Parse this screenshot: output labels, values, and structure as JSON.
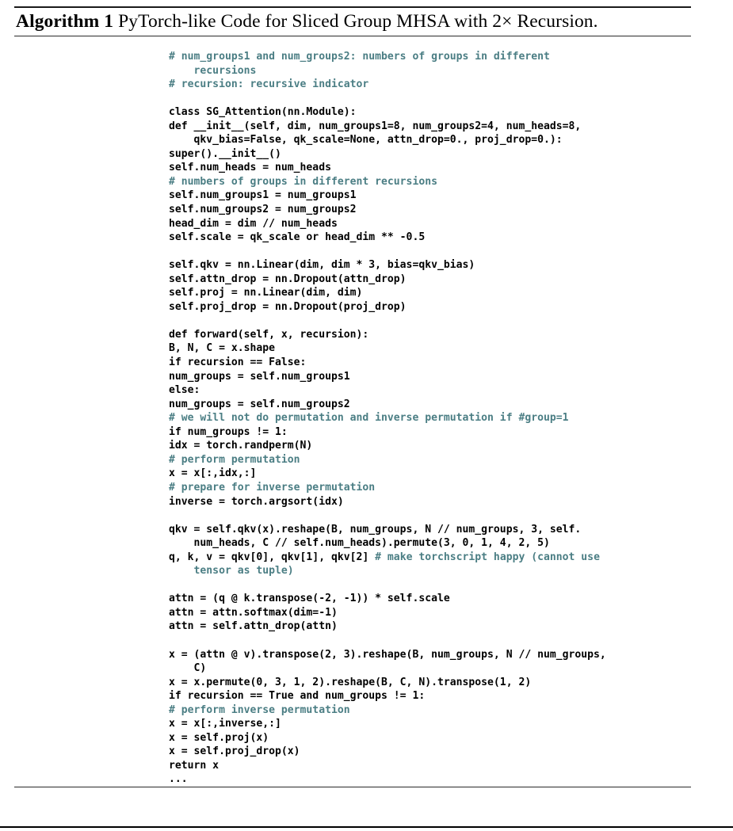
{
  "document": {
    "algorithm_label": "Algorithm 1",
    "algorithm_title": " PyTorch-like Code for Sliced Group MHSA with 2× Recursion.",
    "colors": {
      "text": "#000000",
      "comment": "#4b7e84",
      "rule": "#1a1a1a",
      "page_background": "#ffffff"
    },
    "language": "python"
  },
  "code": {
    "lines": [
      {
        "spans": [
          {
            "t": "comment",
            "s": "# num_groups1 and num_groups2: numbers of groups in different"
          }
        ]
      },
      {
        "spans": [
          {
            "t": "comment",
            "s": "    recursions"
          }
        ]
      },
      {
        "spans": [
          {
            "t": "comment",
            "s": "# recursion: recursive indicator"
          }
        ]
      },
      {
        "blank": true
      },
      {
        "spans": [
          {
            "t": "code",
            "s": "class SG_Attention(nn.Module):"
          }
        ]
      },
      {
        "spans": [
          {
            "t": "code",
            "s": "def __init__(self, dim, num_groups1=8, num_groups2=4, num_heads=8,"
          }
        ]
      },
      {
        "spans": [
          {
            "t": "code",
            "s": "    qkv_bias=False, qk_scale=None, attn_drop=0., proj_drop=0.):"
          }
        ]
      },
      {
        "spans": [
          {
            "t": "code",
            "s": "super().__init__()"
          }
        ]
      },
      {
        "spans": [
          {
            "t": "code",
            "s": "self.num_heads = num_heads"
          }
        ]
      },
      {
        "spans": [
          {
            "t": "comment",
            "s": "# numbers of groups in different recursions"
          }
        ]
      },
      {
        "spans": [
          {
            "t": "code",
            "s": "self.num_groups1 = num_groups1"
          }
        ]
      },
      {
        "spans": [
          {
            "t": "code",
            "s": "self.num_groups2 = num_groups2"
          }
        ]
      },
      {
        "spans": [
          {
            "t": "code",
            "s": "head_dim = dim // num_heads"
          }
        ]
      },
      {
        "spans": [
          {
            "t": "code",
            "s": "self.scale = qk_scale or head_dim ** -0.5"
          }
        ]
      },
      {
        "blank": true
      },
      {
        "spans": [
          {
            "t": "code",
            "s": "self.qkv = nn.Linear(dim, dim * 3, bias=qkv_bias)"
          }
        ]
      },
      {
        "spans": [
          {
            "t": "code",
            "s": "self.attn_drop = nn.Dropout(attn_drop)"
          }
        ]
      },
      {
        "spans": [
          {
            "t": "code",
            "s": "self.proj = nn.Linear(dim, dim)"
          }
        ]
      },
      {
        "spans": [
          {
            "t": "code",
            "s": "self.proj_drop = nn.Dropout(proj_drop)"
          }
        ]
      },
      {
        "blank": true
      },
      {
        "spans": [
          {
            "t": "code",
            "s": "def forward(self, x, recursion):"
          }
        ]
      },
      {
        "spans": [
          {
            "t": "code",
            "s": "B, N, C = x.shape"
          }
        ]
      },
      {
        "spans": [
          {
            "t": "code",
            "s": "if recursion == False:"
          }
        ]
      },
      {
        "spans": [
          {
            "t": "code",
            "s": "num_groups = self.num_groups1"
          }
        ]
      },
      {
        "spans": [
          {
            "t": "code",
            "s": "else:"
          }
        ]
      },
      {
        "spans": [
          {
            "t": "code",
            "s": "num_groups = self.num_groups2"
          }
        ]
      },
      {
        "spans": [
          {
            "t": "comment",
            "s": "# we will not do permutation and inverse permutation if #group=1"
          }
        ]
      },
      {
        "spans": [
          {
            "t": "code",
            "s": "if num_groups != 1:"
          }
        ]
      },
      {
        "spans": [
          {
            "t": "code",
            "s": "idx = torch.randperm(N)"
          }
        ]
      },
      {
        "spans": [
          {
            "t": "comment",
            "s": "# perform permutation"
          }
        ]
      },
      {
        "spans": [
          {
            "t": "code",
            "s": "x = x[:,idx,:]"
          }
        ]
      },
      {
        "spans": [
          {
            "t": "comment",
            "s": "# prepare for inverse permutation"
          }
        ]
      },
      {
        "spans": [
          {
            "t": "code",
            "s": "inverse = torch.argsort(idx)"
          }
        ]
      },
      {
        "blank": true
      },
      {
        "spans": [
          {
            "t": "code",
            "s": "qkv = self.qkv(x).reshape(B, num_groups, N // num_groups, 3, self."
          }
        ]
      },
      {
        "spans": [
          {
            "t": "code",
            "s": "    num_heads, C // self.num_heads).permute(3, 0, 1, 4, 2, 5)"
          }
        ]
      },
      {
        "spans": [
          {
            "t": "code",
            "s": "q, k, v = qkv[0], qkv[1], qkv[2] "
          },
          {
            "t": "comment",
            "s": "# make torchscript happy (cannot use"
          }
        ]
      },
      {
        "spans": [
          {
            "t": "comment",
            "s": "    tensor as tuple)"
          }
        ]
      },
      {
        "blank": true
      },
      {
        "spans": [
          {
            "t": "code",
            "s": "attn = (q @ k.transpose(-2, -1)) * self.scale"
          }
        ]
      },
      {
        "spans": [
          {
            "t": "code",
            "s": "attn = attn.softmax(dim=-1)"
          }
        ]
      },
      {
        "spans": [
          {
            "t": "code",
            "s": "attn = self.attn_drop(attn)"
          }
        ]
      },
      {
        "blank": true
      },
      {
        "spans": [
          {
            "t": "code",
            "s": "x = (attn @ v).transpose(2, 3).reshape(B, num_groups, N // num_groups,"
          }
        ]
      },
      {
        "spans": [
          {
            "t": "code",
            "s": "    C)"
          }
        ]
      },
      {
        "spans": [
          {
            "t": "code",
            "s": "x = x.permute(0, 3, 1, 2).reshape(B, C, N).transpose(1, 2)"
          }
        ]
      },
      {
        "spans": [
          {
            "t": "code",
            "s": "if recursion == True and num_groups != 1:"
          }
        ]
      },
      {
        "spans": [
          {
            "t": "comment",
            "s": "# perform inverse permutation"
          }
        ]
      },
      {
        "spans": [
          {
            "t": "code",
            "s": "x = x[:,inverse,:]"
          }
        ]
      },
      {
        "spans": [
          {
            "t": "code",
            "s": "x = self.proj(x)"
          }
        ]
      },
      {
        "spans": [
          {
            "t": "code",
            "s": "x = self.proj_drop(x)"
          }
        ]
      },
      {
        "spans": [
          {
            "t": "code",
            "s": "return x"
          }
        ]
      },
      {
        "spans": [
          {
            "t": "code",
            "s": "..."
          }
        ]
      }
    ]
  }
}
